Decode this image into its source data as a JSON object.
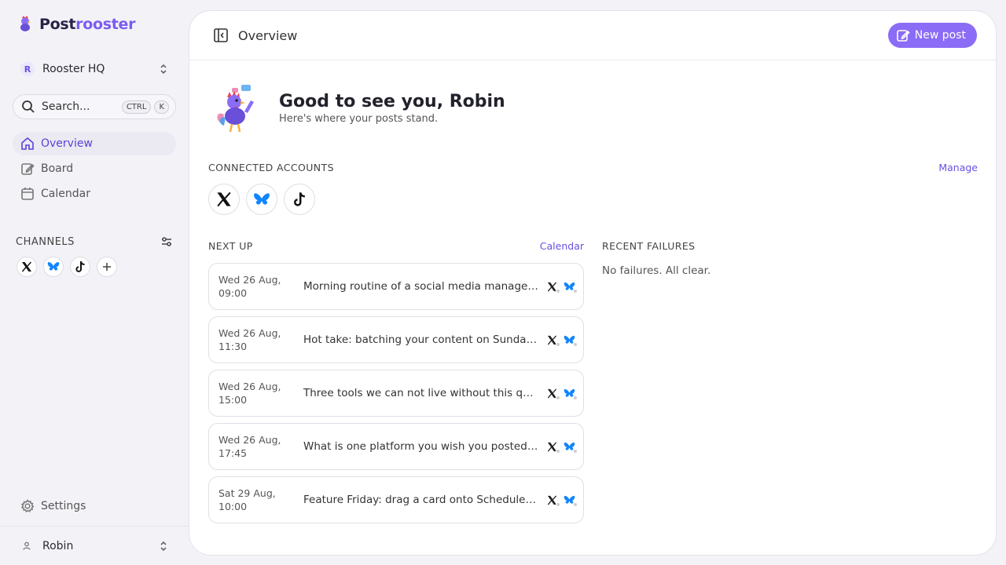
{
  "brand": {
    "part1": "Post",
    "part2": "rooster",
    "accent": "#7b5cf0"
  },
  "workspace": {
    "initial": "R",
    "name": "Rooster HQ"
  },
  "search": {
    "label": "Search...",
    "kbd1": "CTRL",
    "kbd2": "K"
  },
  "nav": [
    {
      "label": "Overview",
      "icon": "home-icon",
      "active": true
    },
    {
      "label": "Board",
      "icon": "edit-icon",
      "active": false
    },
    {
      "label": "Calendar",
      "icon": "calendar-icon",
      "active": false
    }
  ],
  "channels": {
    "title": "CHANNELS",
    "icons": [
      "x-logo-icon",
      "bluesky-logo-icon",
      "tiktok-logo-icon",
      "plus-icon"
    ]
  },
  "settings": {
    "label": "Settings"
  },
  "user": {
    "name": "Robin"
  },
  "topbar": {
    "title": "Overview",
    "new_post": "New post"
  },
  "greeting": {
    "title": "Good to see you, Robin",
    "subtitle": "Here's where your posts stand."
  },
  "connected": {
    "title": "CONNECTED ACCOUNTS",
    "manage": "Manage",
    "icons": [
      "x-logo-icon",
      "bluesky-logo-icon",
      "tiktok-logo-icon"
    ]
  },
  "next_up": {
    "title": "NEXT UP",
    "calendar_link": "Calendar",
    "posts": [
      {
        "date": "Wed 26 Aug,",
        "time": "09:00",
        "text": "Morning routine of a social media manager: coffee, calendar, and a quick scan"
      },
      {
        "date": "Wed 26 Aug,",
        "time": "11:30",
        "text": "Hot take: batching your content on Sunday beats posting on the fly"
      },
      {
        "date": "Wed 26 Aug,",
        "time": "15:00",
        "text": "Three tools we can not live without this quarter"
      },
      {
        "date": "Wed 26 Aug,",
        "time": "17:45",
        "text": "What is one platform you wish you posted to more often?"
      },
      {
        "date": "Sat 29 Aug,",
        "time": "10:00",
        "text": "Feature Friday: drag a card onto Scheduled and it goes out automatically"
      }
    ]
  },
  "failures": {
    "title": "RECENT FAILURES",
    "empty": "No failures. All clear."
  }
}
